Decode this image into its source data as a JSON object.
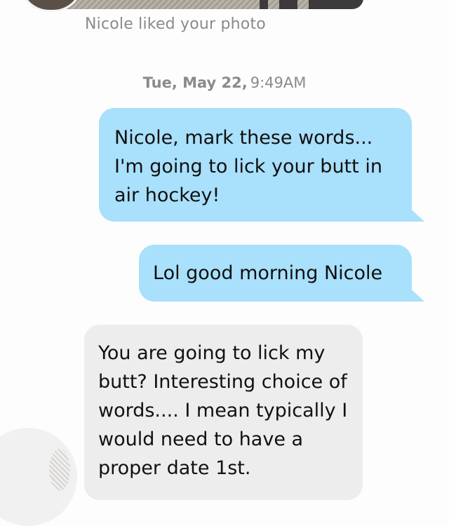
{
  "notification": {
    "liked_text": "Nicole liked your photo"
  },
  "timestamp": {
    "day": "Tue, May 22,",
    "time": "9:49AM"
  },
  "messages": [
    {
      "direction": "outgoing",
      "text": "Nicole, mark these words... I'm going to lick your butt in air hockey!"
    },
    {
      "direction": "outgoing",
      "text": "Lol good morning Nicole"
    },
    {
      "direction": "incoming",
      "text": "You are going to lick my butt? Interesting choice of words.... I mean typically I would need to have a proper date 1st."
    }
  ],
  "colors": {
    "outgoing_bubble": "#a9e0fb",
    "incoming_bubble": "#ededed",
    "meta_text": "#8a8a8a",
    "background": "#fdfdfd"
  },
  "icons": {
    "top_avatar": "profile-photo",
    "bottom_avatar": "profile-photo"
  }
}
